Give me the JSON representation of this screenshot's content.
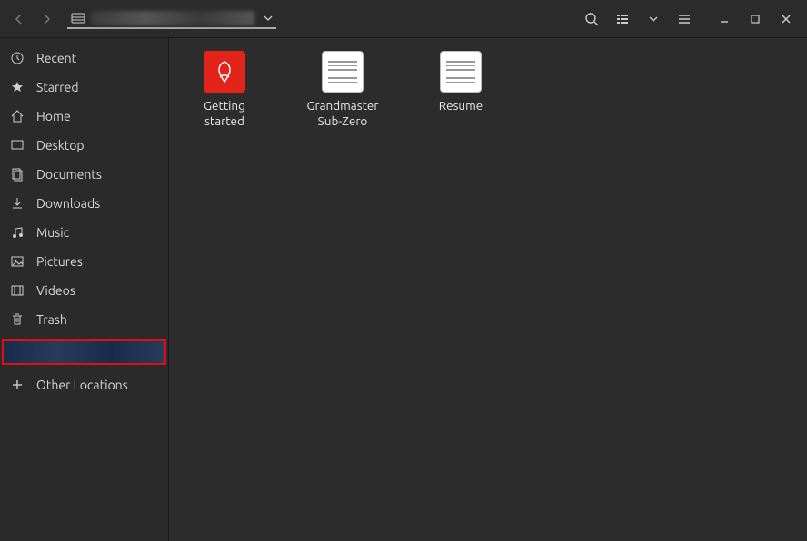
{
  "sidebar": {
    "items": [
      {
        "label": "Recent"
      },
      {
        "label": "Starred"
      },
      {
        "label": "Home"
      },
      {
        "label": "Desktop"
      },
      {
        "label": "Documents"
      },
      {
        "label": "Downloads"
      },
      {
        "label": "Music"
      },
      {
        "label": "Pictures"
      },
      {
        "label": "Videos"
      },
      {
        "label": "Trash"
      }
    ],
    "other_locations_label": "Other Locations"
  },
  "files": [
    {
      "label": "Getting started",
      "kind": "pdf"
    },
    {
      "label": "Grandmaster Sub-Zero",
      "kind": "doc"
    },
    {
      "label": "Resume",
      "kind": "doc"
    }
  ]
}
